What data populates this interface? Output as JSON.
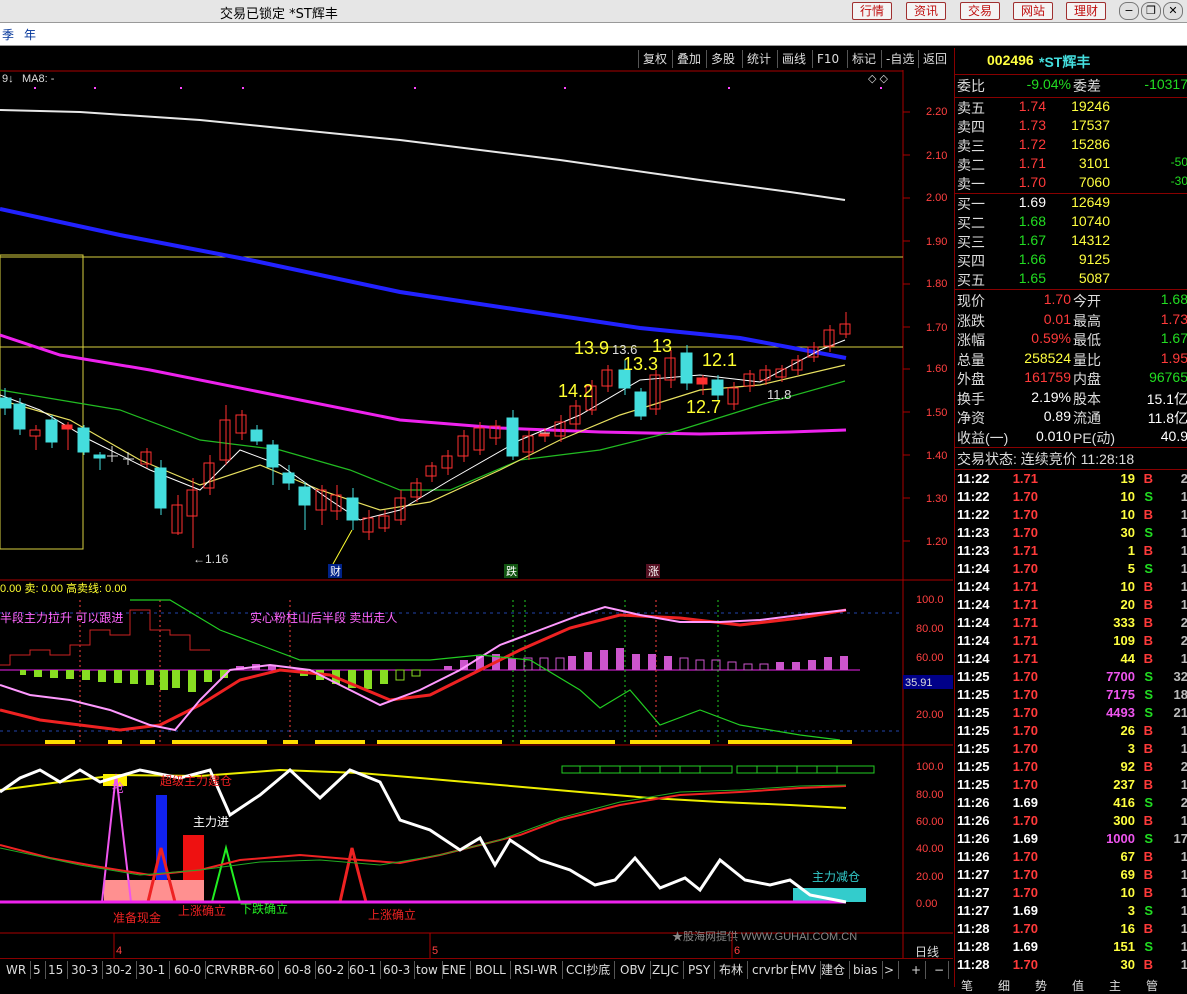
{
  "window": {
    "title": "交易已锁定  *ST辉丰",
    "buttons": [
      "行情",
      "资讯",
      "交易",
      "网站",
      "理财"
    ]
  },
  "menu": [
    "季",
    "年"
  ],
  "toolbar": [
    "复权",
    "叠加",
    "多股",
    "统计",
    "画线",
    "F10",
    "标记",
    "-自选",
    "返回"
  ],
  "main": {
    "ma_label": "MA8: -",
    "ma_prefix": "9↓",
    "price_ticks": [
      "2.20",
      "2.10",
      "2.00",
      "1.90",
      "1.80",
      "1.70",
      "1.60",
      "1.50",
      "1.40",
      "1.30",
      "1.20"
    ],
    "annotations": [
      "13.9",
      "13.6",
      "13",
      "13.3",
      "12.1",
      "14.2",
      "12.7",
      "11.8",
      "←1.16"
    ],
    "events": [
      "财",
      "跌",
      "涨"
    ],
    "ind1_header": "0.00 卖: 0.00 高卖线: 0.00",
    "ind1_texts": [
      "半段主力拉升  可以跟进",
      "实心粉柱山后半段  卖出走人"
    ],
    "ind1_ticks": [
      "100.0",
      "80.00",
      "60.00",
      "20.00"
    ],
    "ind1_value": "35.91",
    "ind2_ticks": [
      "100.0",
      "80.00",
      "60.00",
      "40.00",
      "20.00",
      "0.00"
    ],
    "ind2_texts": [
      "超级主力建仓",
      "主力进",
      "准备现金",
      "上涨确立",
      "下跌确立",
      "上涨确立",
      "主力减仓",
      "抢"
    ],
    "watermark": "★股海网提供 WWW.GUHAI.COM.CN",
    "months": [
      "4",
      "5",
      "6"
    ],
    "period": "日线"
  },
  "bottom_tabs": [
    "WR",
    "5",
    "15",
    "30-3",
    "30-2",
    "30-1",
    "60-0",
    "CRVRBR-60",
    "60-8",
    "60-2",
    "60-1",
    "60-3",
    "tow",
    "ENE",
    "BOLL",
    "RSI-WR",
    "CCI抄底",
    "OBV",
    "ZLJC",
    "PSY",
    "布林",
    "crvrbr",
    "EMV",
    "建仓",
    "bias",
    ">",
    "+",
    "−"
  ],
  "quote": {
    "code": "002496",
    "name": "*ST辉丰",
    "weibi_label": "委比",
    "weibi": "-9.04%",
    "weicha_label": "委差",
    "weicha": "-10317",
    "asks": [
      {
        "label": "卖五",
        "price": "1.74",
        "vol": "19246",
        "chg": ""
      },
      {
        "label": "卖四",
        "price": "1.73",
        "vol": "17537",
        "chg": ""
      },
      {
        "label": "卖三",
        "price": "1.72",
        "vol": "15286",
        "chg": ""
      },
      {
        "label": "卖二",
        "price": "1.71",
        "vol": "3101",
        "chg": "-50"
      },
      {
        "label": "卖一",
        "price": "1.70",
        "vol": "7060",
        "chg": "-30"
      }
    ],
    "bids": [
      {
        "label": "买一",
        "price": "1.69",
        "vol": "12649"
      },
      {
        "label": "买二",
        "price": "1.68",
        "vol": "10740"
      },
      {
        "label": "买三",
        "price": "1.67",
        "vol": "14312"
      },
      {
        "label": "买四",
        "price": "1.66",
        "vol": "9125"
      },
      {
        "label": "买五",
        "price": "1.65",
        "vol": "5087"
      }
    ],
    "stats": [
      {
        "l1": "现价",
        "v1": "1.70",
        "l2": "今开",
        "v2": "1.68"
      },
      {
        "l1": "涨跌",
        "v1": "0.01",
        "l2": "最高",
        "v2": "1.73"
      },
      {
        "l1": "涨幅",
        "v1": "0.59%",
        "l2": "最低",
        "v2": "1.67"
      },
      {
        "l1": "总量",
        "v1": "258524",
        "l2": "量比",
        "v2": "1.95"
      },
      {
        "l1": "外盘",
        "v1": "161759",
        "l2": "内盘",
        "v2": "96765"
      },
      {
        "l1": "换手",
        "v1": "2.19%",
        "l2": "股本",
        "v2": "15.1亿"
      },
      {
        "l1": "净资",
        "v1": "0.89",
        "l2": "流通",
        "v2": "11.8亿"
      },
      {
        "l1": "收益(一)",
        "v1": "0.010",
        "l2": "PE(动)",
        "v2": "40.9"
      }
    ],
    "status": "交易状态: 连续竞价 11:28:18",
    "ticks": [
      [
        "11:22",
        "1.71",
        "19",
        "B",
        "2"
      ],
      [
        "11:22",
        "1.70",
        "10",
        "S",
        "1"
      ],
      [
        "11:22",
        "1.70",
        "10",
        "B",
        "1"
      ],
      [
        "11:23",
        "1.70",
        "30",
        "S",
        "1"
      ],
      [
        "11:23",
        "1.71",
        "1",
        "B",
        "1"
      ],
      [
        "11:24",
        "1.70",
        "5",
        "S",
        "1"
      ],
      [
        "11:24",
        "1.71",
        "10",
        "B",
        "1"
      ],
      [
        "11:24",
        "1.71",
        "20",
        "B",
        "1"
      ],
      [
        "11:24",
        "1.71",
        "333",
        "B",
        "2"
      ],
      [
        "11:24",
        "1.71",
        "109",
        "B",
        "2"
      ],
      [
        "11:24",
        "1.71",
        "44",
        "B",
        "1"
      ],
      [
        "11:25",
        "1.70",
        "7700",
        "S",
        "32"
      ],
      [
        "11:25",
        "1.70",
        "7175",
        "S",
        "18"
      ],
      [
        "11:25",
        "1.70",
        "4493",
        "S",
        "21"
      ],
      [
        "11:25",
        "1.70",
        "26",
        "B",
        "1"
      ],
      [
        "11:25",
        "1.70",
        "3",
        "B",
        "1"
      ],
      [
        "11:25",
        "1.70",
        "92",
        "B",
        "2"
      ],
      [
        "11:25",
        "1.70",
        "237",
        "B",
        "1"
      ],
      [
        "11:26",
        "1.69",
        "416",
        "S",
        "2"
      ],
      [
        "11:26",
        "1.70",
        "300",
        "B",
        "1"
      ],
      [
        "11:26",
        "1.69",
        "1000",
        "S",
        "17"
      ],
      [
        "11:26",
        "1.70",
        "67",
        "B",
        "1"
      ],
      [
        "11:27",
        "1.70",
        "69",
        "B",
        "1"
      ],
      [
        "11:27",
        "1.70",
        "10",
        "B",
        "1"
      ],
      [
        "11:27",
        "1.69",
        "3",
        "S",
        "1"
      ],
      [
        "11:28",
        "1.70",
        "16",
        "B",
        "1"
      ],
      [
        "11:28",
        "1.69",
        "151",
        "S",
        "1"
      ],
      [
        "11:28",
        "1.70",
        "30",
        "B",
        "1"
      ]
    ],
    "panel_tabs": [
      "笔",
      "细",
      "势",
      "值",
      "主",
      "管"
    ]
  }
}
